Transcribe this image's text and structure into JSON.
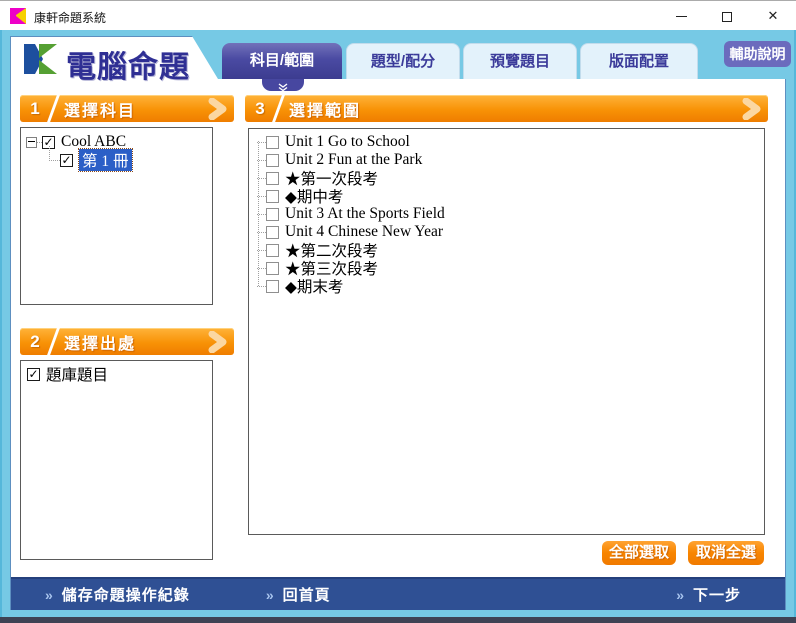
{
  "window": {
    "title": "康軒命題系統"
  },
  "header": {
    "logo_text": "電腦命題",
    "help_button_label": "輔助說明",
    "tabs": [
      {
        "label": "科目/範圍",
        "active": true
      },
      {
        "label": "題型/配分",
        "active": false
      },
      {
        "label": "預覽題目",
        "active": false
      },
      {
        "label": "版面配置",
        "active": false
      }
    ]
  },
  "sections": {
    "subject": {
      "number": "1",
      "title": "選擇科目",
      "tree": [
        {
          "label": "Cool ABC",
          "checked": true,
          "expanded": true,
          "selected": false
        },
        {
          "label": "第 1 冊",
          "checked": true,
          "selected": true
        }
      ]
    },
    "source": {
      "number": "2",
      "title": "選擇出處",
      "items": [
        {
          "label": "題庫題目",
          "checked": true
        }
      ]
    },
    "range": {
      "number": "3",
      "title": "選擇範圍",
      "items": [
        {
          "label": "Unit 1 Go to School",
          "checked": false
        },
        {
          "label": "Unit 2 Fun at the Park",
          "checked": false
        },
        {
          "label": "★第一次段考",
          "checked": false
        },
        {
          "label": "◆期中考",
          "checked": false
        },
        {
          "label": "Unit 3 At the Sports Field",
          "checked": false
        },
        {
          "label": "Unit 4 Chinese New Year",
          "checked": false
        },
        {
          "label": "★第二次段考",
          "checked": false
        },
        {
          "label": "★第三次段考",
          "checked": false
        },
        {
          "label": "◆期末考",
          "checked": false
        }
      ],
      "select_all_label": "全部選取",
      "deselect_all_label": "取消全選"
    }
  },
  "footer": {
    "chevron_glyph": "»",
    "save_label": "儲存命題操作紀錄",
    "home_label": "回首頁",
    "next_label": "下一步"
  },
  "colors": {
    "accent_orange": "#f78a00",
    "active_tab_purple": "#44449a",
    "frame_blue": "#76c9e5",
    "footer_blue": "#2f5094",
    "selection_blue": "#2b5fc7",
    "help_purple": "#6b6bbd"
  }
}
